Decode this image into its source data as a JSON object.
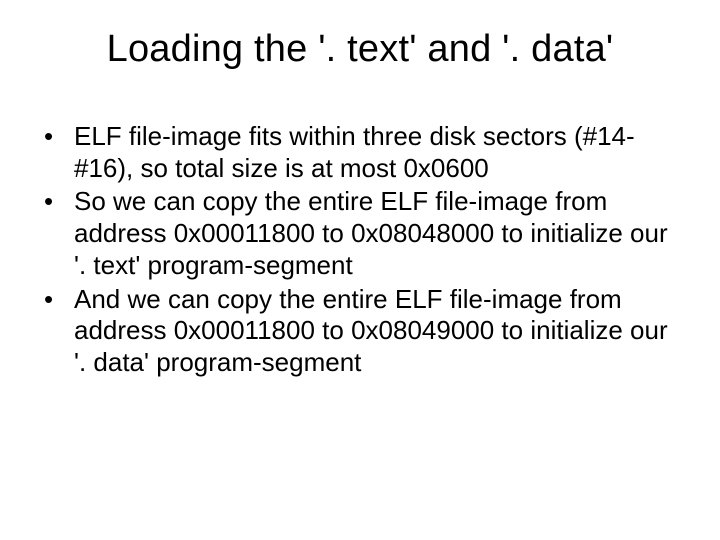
{
  "title": "Loading the '. text' and '. data'",
  "bullets": [
    "ELF file-image fits within three disk sectors (#14-#16), so total size is at most 0x0600",
    "So we can copy the entire ELF file-image from address 0x00011800 to 0x08048000 to initialize our '. text' program-segment",
    "And we can copy the entire ELF file-image from address 0x00011800 to 0x08049000 to initialize our '. data' program-segment"
  ]
}
